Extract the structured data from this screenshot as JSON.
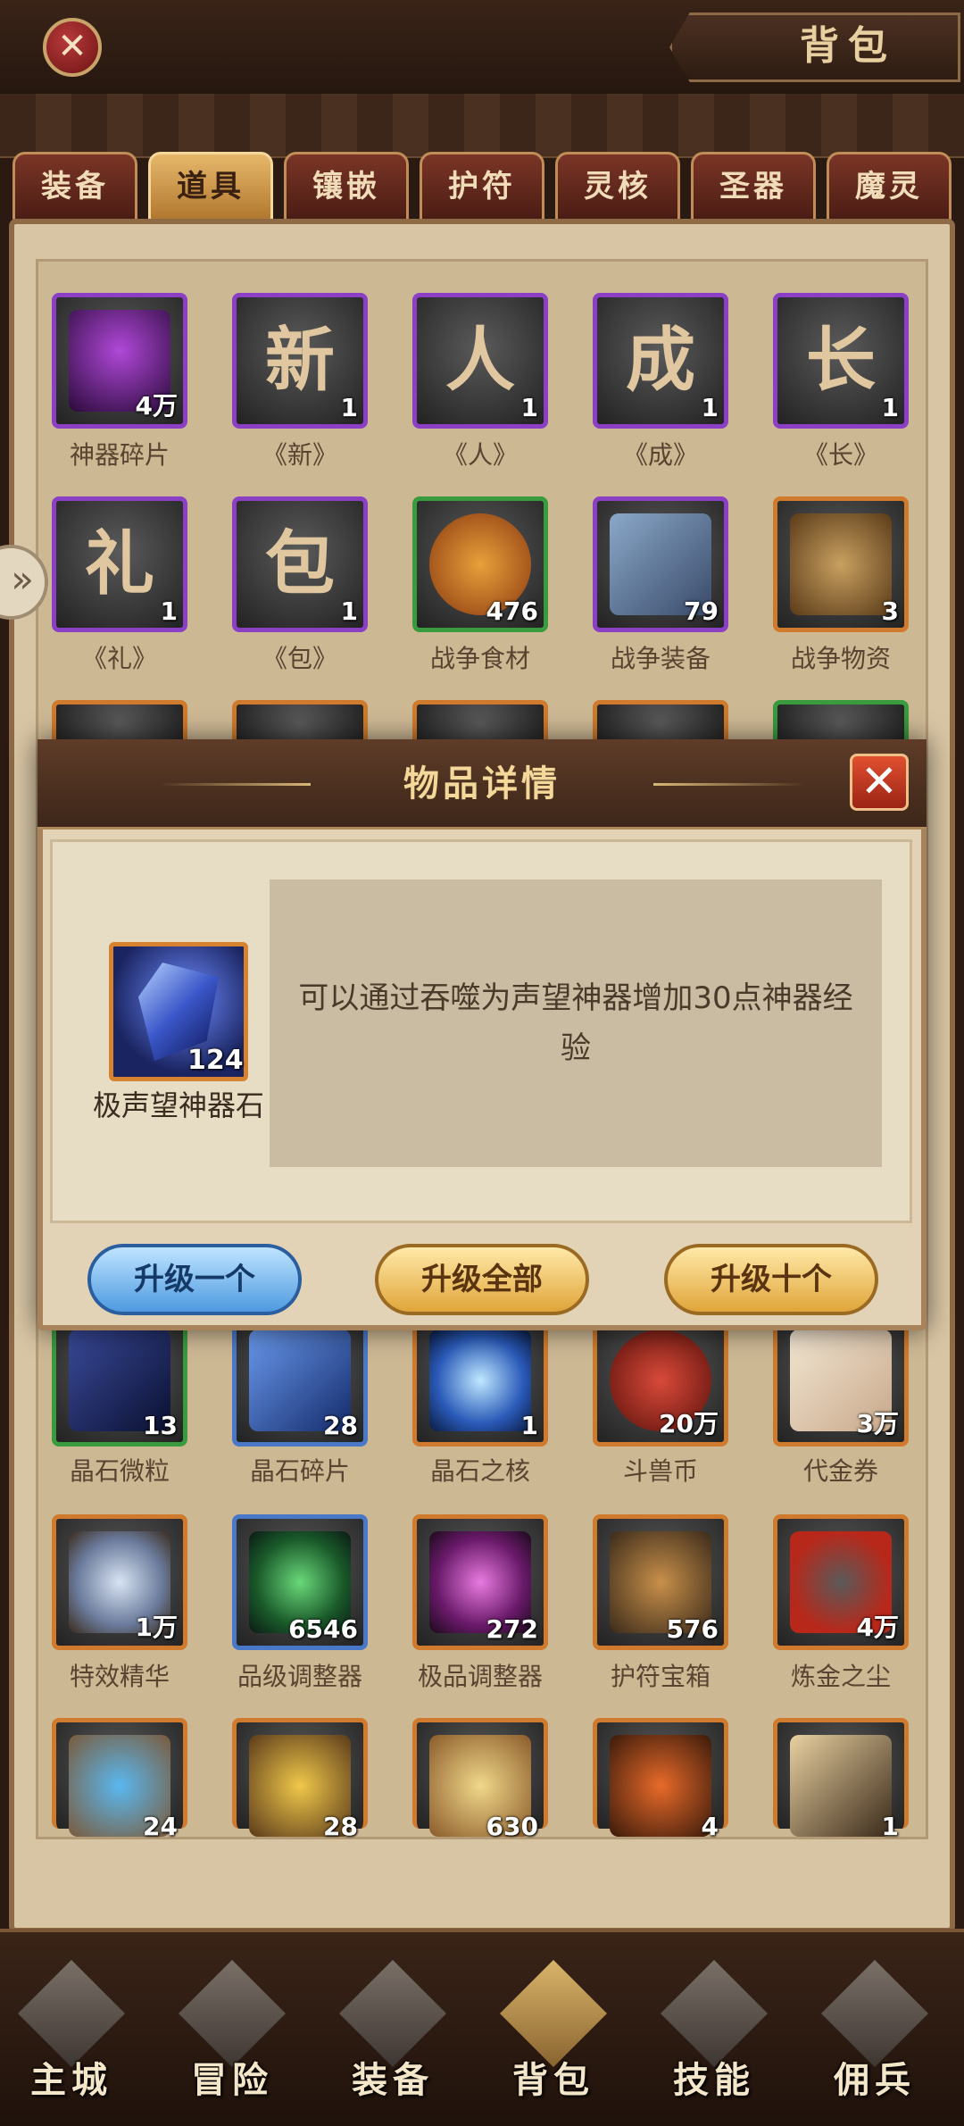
{
  "header": {
    "title": "背包"
  },
  "tabs": [
    {
      "label": "装备",
      "active": false
    },
    {
      "label": "道具",
      "active": true
    },
    {
      "label": "镶嵌",
      "active": false
    },
    {
      "label": "护符",
      "active": false
    },
    {
      "label": "灵核",
      "active": false
    },
    {
      "label": "圣器",
      "active": false
    },
    {
      "label": "魔灵",
      "active": false
    }
  ],
  "items": {
    "row1": [
      {
        "name": "神器碎片",
        "count": "4万",
        "icon": "dragon-shard-icon"
      },
      {
        "name": "《新》",
        "count": "1",
        "glyph": "新"
      },
      {
        "name": "《人》",
        "count": "1",
        "glyph": "人"
      },
      {
        "name": "《成》",
        "count": "1",
        "glyph": "成"
      },
      {
        "name": "《长》",
        "count": "1",
        "glyph": "长"
      }
    ],
    "row2": [
      {
        "name": "《礼》",
        "count": "1",
        "glyph": "礼"
      },
      {
        "name": "《包》",
        "count": "1",
        "glyph": "包"
      },
      {
        "name": "战争食材",
        "count": "476",
        "icon": "food-icon"
      },
      {
        "name": "战争装备",
        "count": "79",
        "icon": "armor-icon"
      },
      {
        "name": "战争物资",
        "count": "3",
        "icon": "supplies-icon"
      }
    ],
    "row4": [
      {
        "name": "晶石微粒",
        "count": "13",
        "icon": "crystal-particle-icon"
      },
      {
        "name": "晶石碎片",
        "count": "28",
        "icon": "crystal-shard-icon"
      },
      {
        "name": "晶石之核",
        "count": "1",
        "icon": "crystal-core-icon"
      },
      {
        "name": "斗兽币",
        "count": "20万",
        "icon": "beast-coin-icon"
      },
      {
        "name": "代金券",
        "count": "3万",
        "icon": "voucher-icon"
      }
    ],
    "row5": [
      {
        "name": "特效精华",
        "count": "1万",
        "icon": "essence-icon"
      },
      {
        "name": "品级调整器",
        "count": "6546",
        "icon": "grade-adjuster-icon"
      },
      {
        "name": "极品调整器",
        "count": "272",
        "icon": "premium-adjuster-icon"
      },
      {
        "name": "护符宝箱",
        "count": "576",
        "icon": "amulet-chest-icon"
      },
      {
        "name": "炼金之尘",
        "count": "4万",
        "icon": "alchemy-dust-icon"
      }
    ],
    "row6": [
      {
        "count": "24"
      },
      {
        "count": "28"
      },
      {
        "count": "630"
      },
      {
        "count": "4"
      },
      {
        "count": "1"
      }
    ]
  },
  "modal": {
    "title": "物品详情",
    "item_name": "极声望神器石",
    "item_count": "124",
    "description": "可以通过吞噬为声望神器增加30点神器经验",
    "buttons": {
      "one": "升级一个",
      "all": "升级全部",
      "ten": "升级十个"
    }
  },
  "nav": [
    {
      "label": "主城"
    },
    {
      "label": "冒险"
    },
    {
      "label": "装备"
    },
    {
      "label": "背包",
      "active": true
    },
    {
      "label": "技能"
    },
    {
      "label": "佣兵"
    }
  ],
  "colors": {
    "rarity_purple": "#8a3fc4",
    "rarity_green": "#3a9a3e",
    "rarity_blue": "#4a78c8",
    "rarity_orange": "#cf7a2c"
  }
}
